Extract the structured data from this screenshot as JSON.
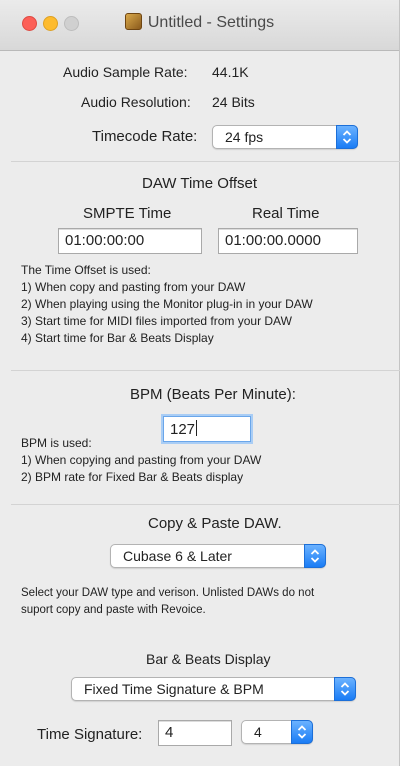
{
  "window": {
    "title": "Untitled - Settings"
  },
  "audio": {
    "sample_rate_label": "Audio Sample Rate:",
    "sample_rate_value": "44.1K",
    "resolution_label": "Audio Resolution:",
    "resolution_value": "24 Bits",
    "timecode_label": "Timecode Rate:",
    "timecode_value": "24 fps"
  },
  "daw_offset": {
    "heading": "DAW Time Offset",
    "smpte_label": "SMPTE Time",
    "realtime_label": "Real Time",
    "smpte_value": "01:00:00:00",
    "realtime_value": "01:00:00.0000",
    "notes": [
      "The Time Offset is used:",
      "1) When copy and pasting from your DAW",
      "2) When playing using the Monitor plug-in in your DAW",
      "3) Start time for MIDI files imported from your DAW",
      "4) Start time for Bar & Beats Display"
    ]
  },
  "bpm": {
    "heading": "BPM (Beats Per Minute):",
    "value": "127",
    "notes": [
      "BPM is used:",
      "1) When copying and pasting from your DAW",
      "2) BPM rate for Fixed Bar & Beats display"
    ]
  },
  "copy_paste": {
    "heading": "Copy & Paste DAW.",
    "daw_value": "Cubase 6 & Later",
    "notes": [
      "Select your DAW type and verison. Unlisted DAWs do not",
      "suport copy and paste with Revoice."
    ]
  },
  "bar_beats": {
    "heading": "Bar & Beats Display",
    "mode_value": "Fixed Time Signature & BPM",
    "time_sig_label": "Time Signature:",
    "numerator": "4",
    "denominator": "4"
  },
  "colors": {
    "accent": "#1a7cf5",
    "focus_ring": "#a9cdf5",
    "window_bg": "#ececec"
  }
}
